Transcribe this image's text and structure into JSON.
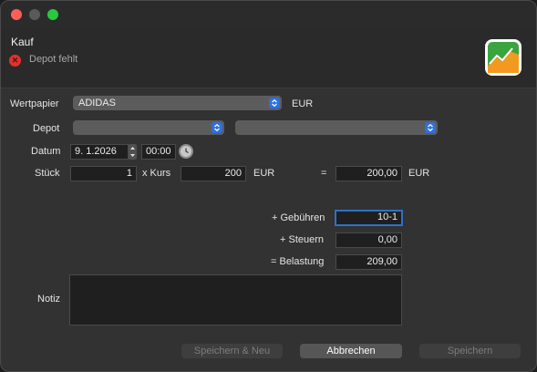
{
  "window": {
    "title": "Kauf",
    "error_message": "Depot fehlt"
  },
  "form": {
    "security": {
      "label": "Wertpapier",
      "value": "ADIDAS",
      "currency": "EUR"
    },
    "depot": {
      "label": "Depot",
      "value1": "",
      "value2": ""
    },
    "date": {
      "label": "Datum",
      "value": "9.  1.2026",
      "time": "00:00"
    },
    "quantity": {
      "label": "Stück",
      "value": "1",
      "times_label": "x Kurs",
      "price": "200",
      "price_currency": "EUR",
      "equals": "=",
      "subtotal": "200,00",
      "subtotal_currency": "EUR"
    },
    "fees": {
      "label": "+ Gebühren",
      "value": "10-1"
    },
    "taxes": {
      "label": "+ Steuern",
      "value": "0,00"
    },
    "total": {
      "label": "= Belastung",
      "value": "209,00"
    },
    "note": {
      "label": "Notiz",
      "value": ""
    }
  },
  "buttons": {
    "save_new": "Speichern & Neu",
    "cancel": "Abbrechen",
    "save": "Speichern"
  },
  "icons": {
    "error": "error-x-icon",
    "logo": "app-chart-logo-icon",
    "select": "chevron-updown-icon",
    "clock": "clock-icon",
    "stepper": "stepper-icon"
  },
  "colors": {
    "accent": "#2f6fe0",
    "error": "#e0332e",
    "focus": "#2f70c8"
  }
}
